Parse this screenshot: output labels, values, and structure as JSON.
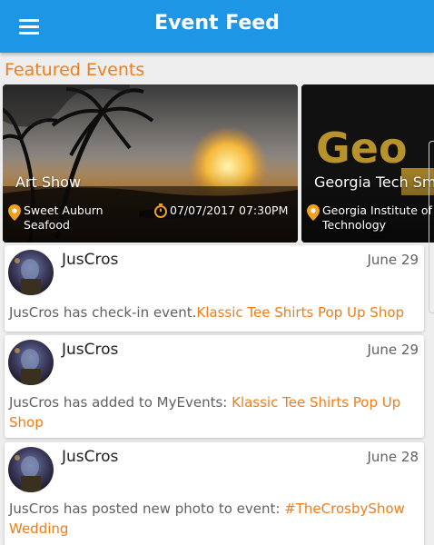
{
  "app_bar": {
    "title": "Event Feed",
    "menu_icon": "hamburger-menu-icon",
    "background_color": "#1e96e6"
  },
  "featured": {
    "section_title": "Featured Events",
    "accent_color": "#ef7d1a",
    "events": [
      {
        "title": "Art Show",
        "location_line1": "Sweet Auburn",
        "location_line2": "Seafood",
        "datetime": "07/07/2017 07:30PM",
        "location_icon": "map-pin-icon",
        "time_icon": "stopwatch-icon"
      },
      {
        "title": "Georgia Tech Sm",
        "location_line1": "Georgia Institute of",
        "location_line2": "Technology",
        "image_text": "Geo",
        "location_icon": "map-pin-icon"
      }
    ]
  },
  "feed": [
    {
      "user": "JusCros",
      "date": "June 29",
      "text": "JusCros has check-in event.",
      "link": "Klassic Tee Shirts Pop Up Shop"
    },
    {
      "user": "JusCros",
      "date": "June 29",
      "text": "JusCros has added to MyEvents: ",
      "link": "Klassic Tee Shirts Pop Up Shop"
    },
    {
      "user": "JusCros",
      "date": "June 28",
      "text": "JusCros has posted new photo to event: ",
      "link": "#TheCrosbyShow Wedding"
    }
  ]
}
